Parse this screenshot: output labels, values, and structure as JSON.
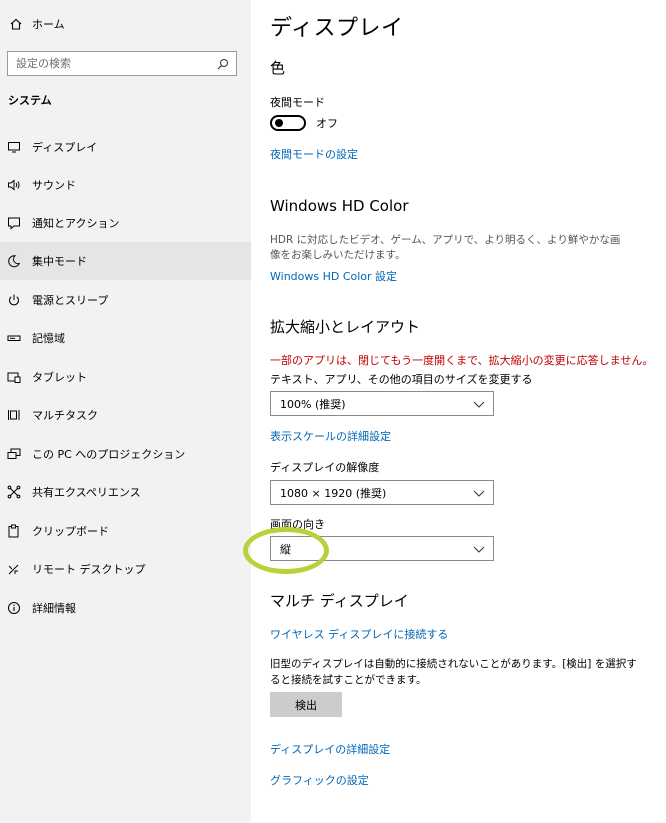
{
  "sidebar": {
    "home_label": "ホーム",
    "search_placeholder": "設定の検索",
    "section_title": "システム",
    "items": [
      {
        "label": "ディスプレイ",
        "icon": "monitor-icon"
      },
      {
        "label": "サウンド",
        "icon": "speaker-icon"
      },
      {
        "label": "通知とアクション",
        "icon": "notification-icon"
      },
      {
        "label": "集中モード",
        "icon": "moon-icon",
        "active": true
      },
      {
        "label": "電源とスリープ",
        "icon": "power-icon"
      },
      {
        "label": "記憶域",
        "icon": "storage-icon"
      },
      {
        "label": "タブレット",
        "icon": "tablet-icon"
      },
      {
        "label": "マルチタスク",
        "icon": "multitask-icon"
      },
      {
        "label": "この PC へのプロジェクション",
        "icon": "projection-icon"
      },
      {
        "label": "共有エクスペリエンス",
        "icon": "shared-experience-icon"
      },
      {
        "label": "クリップボード",
        "icon": "clipboard-icon"
      },
      {
        "label": "リモート デスクトップ",
        "icon": "remote-desktop-icon"
      },
      {
        "label": "詳細情報",
        "icon": "info-icon"
      }
    ]
  },
  "main": {
    "title": "ディスプレイ",
    "color_heading": "色",
    "night_mode_label": "夜間モード",
    "night_mode_state": "オフ",
    "night_mode_settings_link": "夜間モードの設定",
    "hd_color_heading": "Windows HD Color",
    "hd_color_desc": "HDR に対応したビデオ、ゲーム、アプリで、より明るく、より鮮やかな画像をお楽しみいただけます。",
    "hd_color_link": "Windows HD Color 設定",
    "scale_heading": "拡大縮小とレイアウト",
    "scale_warning": "一部のアプリは、閉じてもう一度開くまで、拡大縮小の変更に応答しません。",
    "scale_label": "テキスト、アプリ、その他の項目のサイズを変更する",
    "scale_value": "100% (推奨)",
    "scale_advanced_link": "表示スケールの詳細設定",
    "resolution_label": "ディスプレイの解像度",
    "resolution_value": "1080 × 1920 (推奨)",
    "orientation_label": "画面の向き",
    "orientation_value": "縦",
    "multi_heading": "マルチ ディスプレイ",
    "wireless_link": "ワイヤレス ディスプレイに接続する",
    "detect_desc": "旧型のディスプレイは自動的に接続されないことがあります。[検出] を選択すると接続を試すことができます。",
    "detect_button": "検出",
    "advanced_display_link": "ディスプレイの詳細設定",
    "graphics_link": "グラフィックの設定"
  },
  "colors": {
    "link": "#0067b8",
    "warning": "#c00000",
    "highlight_circle": "#b5d33a",
    "sidebar_bg": "#f2f2f2",
    "active_item_bg": "#e5e5e5"
  }
}
